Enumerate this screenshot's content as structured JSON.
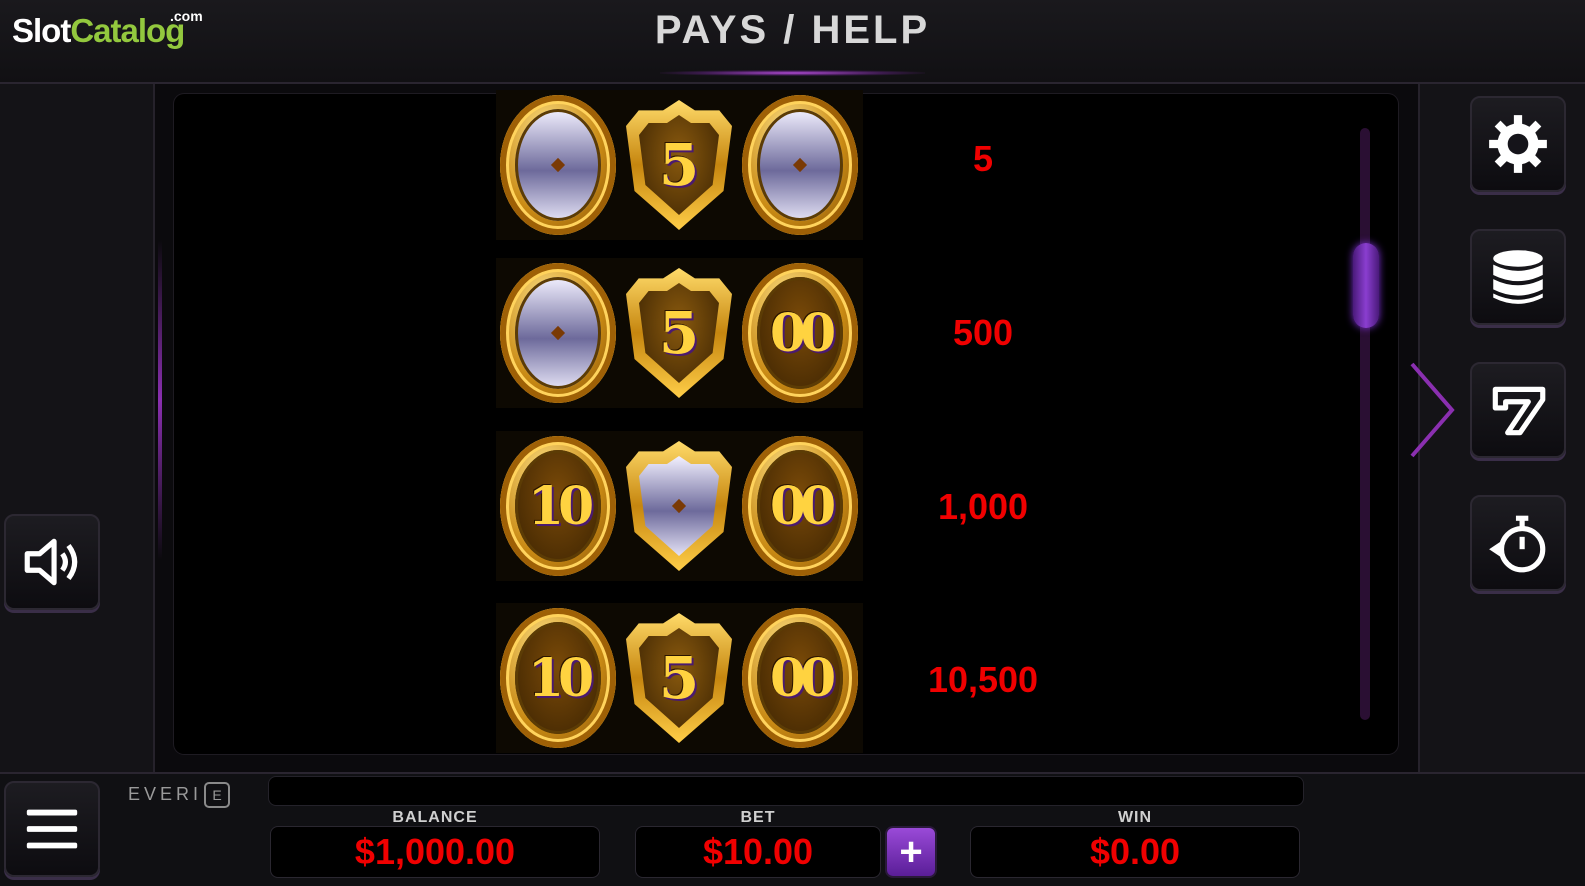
{
  "logo": {
    "part1": "Slot",
    "part2": "Catalog",
    "suffix": ".com"
  },
  "header": {
    "title": "PAYS / HELP"
  },
  "paytable": {
    "rows": [
      {
        "symbols": [
          "blank",
          "5",
          "blank"
        ],
        "payout": "5"
      },
      {
        "symbols": [
          "blank",
          "5",
          "00"
        ],
        "payout": "500"
      },
      {
        "symbols": [
          "10",
          "blank",
          "00"
        ],
        "payout": "1,000"
      },
      {
        "symbols": [
          "10",
          "5",
          "00"
        ],
        "payout": "10,500"
      }
    ],
    "scroll_position": 0.2
  },
  "side_buttons": {
    "settings_icon": "gear-icon",
    "bet_icon": "coin-stack-icon",
    "paytable_icon": "seven-icon",
    "autoplay_icon": "stopwatch-icon",
    "sound_icon": "speaker-icon",
    "menu_icon": "hamburger-icon"
  },
  "brand": {
    "name": "EVERI",
    "mark": "E"
  },
  "meters": {
    "balance_label": "BALANCE",
    "balance_value": "$1,000.00",
    "bet_label": "BET",
    "bet_value": "$10.00",
    "bet_plus": "+",
    "win_label": "WIN",
    "win_value": "$0.00"
  },
  "colors": {
    "accent": "#8a3ed0",
    "value_red": "#f00000",
    "gold": "#d9a020"
  }
}
